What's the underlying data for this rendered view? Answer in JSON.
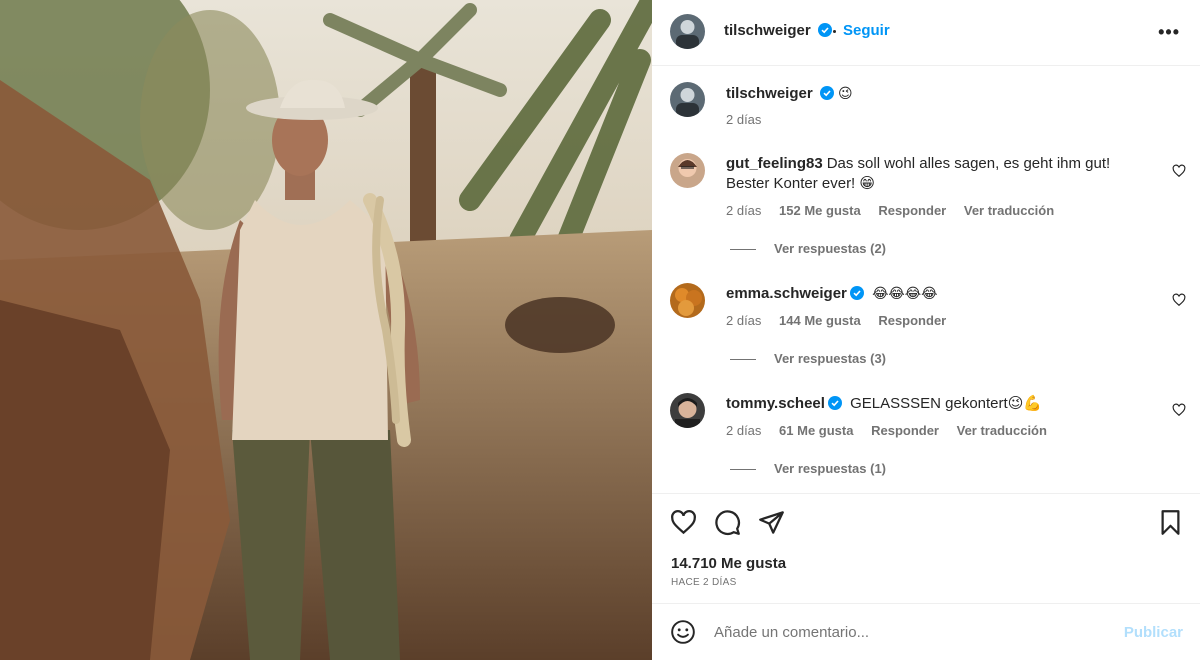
{
  "accent_color": "#0095f6",
  "post_author": {
    "username": "tilschweiger",
    "follow_label": "Seguir",
    "more_label": "•••"
  },
  "caption": {
    "username": "tilschweiger",
    "emoji": "😉",
    "time": "2 días"
  },
  "comments": [
    {
      "username": "gut_feeling83",
      "text_line1": "Das soll wohl alles sagen, es geht ihm gut!",
      "text_line2": "Bester Konter ever! 😁",
      "time": "2 días",
      "likes": "152 Me gusta",
      "reply": "Responder",
      "translate": "Ver traducción",
      "view_replies": "Ver respuestas (2)"
    },
    {
      "username": "emma.schweiger",
      "text": "😂😂😂😂",
      "time": "2 días",
      "likes": "144 Me gusta",
      "reply": "Responder",
      "view_replies": "Ver respuestas (3)"
    },
    {
      "username": "tommy.scheel",
      "text": "GELASSSEN gekontert😉💪",
      "time": "2 días",
      "likes": "61 Me gusta",
      "reply": "Responder",
      "translate": "Ver traducción",
      "view_replies": "Ver respuestas (1)"
    }
  ],
  "post_stats": {
    "likes": "14.710 Me gusta",
    "posted": "HACE 2 DÍAS"
  },
  "comment_box": {
    "placeholder": "Añade un comentario...",
    "publish_label": "Publicar",
    "emoji_icon": "smiley-icon"
  }
}
